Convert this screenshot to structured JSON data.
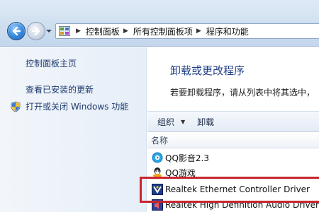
{
  "address_bar": {
    "breadcrumbs": [
      "控制面板",
      "所有控制面板项",
      "程序和功能"
    ]
  },
  "left_pane": {
    "links": [
      "控制面板主页",
      "查看已安装的更新",
      "打开或关闭 Windows 功能"
    ]
  },
  "main": {
    "title": "卸载或更改程序",
    "subtitle": "若要卸载程序，请从列表中将其选中，"
  },
  "toolbar": {
    "organize_label": "组织",
    "uninstall_label": "卸载"
  },
  "list": {
    "column_name": "名称",
    "items": [
      {
        "name": "QQ影音2.3",
        "icon": "qqplayer-icon"
      },
      {
        "name": "QQ游戏",
        "icon": "qqgame-icon"
      },
      {
        "name": "Realtek Ethernet Controller Driver",
        "icon": "realtek-icon"
      },
      {
        "name": "Realtek High Definition Audio Driver",
        "icon": "realtek-audio-icon"
      }
    ]
  },
  "colors": {
    "title": "#1f3f86",
    "link": "#1e3a6e",
    "highlight_box": "#c8262e"
  }
}
